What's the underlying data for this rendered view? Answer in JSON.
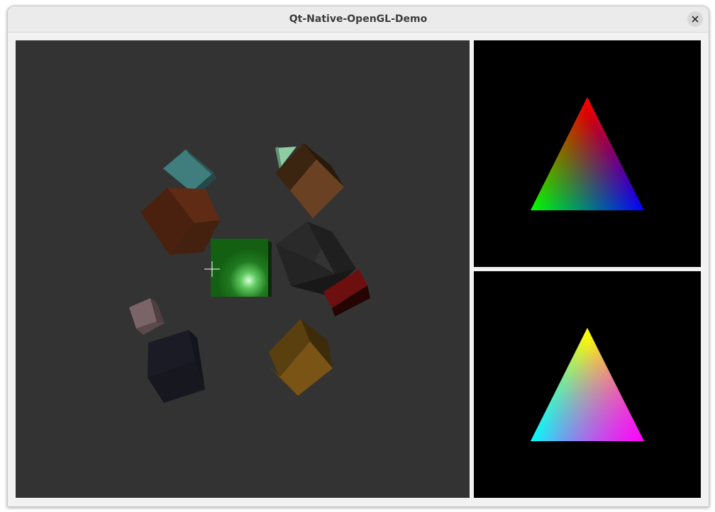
{
  "window": {
    "title": "Qt-Native-OpenGL-Demo"
  },
  "titlebar": {
    "close_icon": "close-icon"
  },
  "views": {
    "main_view": "cubes-scene",
    "side_top_view": "rgb-triangle",
    "side_bottom_view": "cmy-triangle"
  },
  "colors": {
    "main_background": "#333333",
    "side_background": "#000000",
    "triangle_top": [
      "#ff0000",
      "#00ff00",
      "#0000ff"
    ],
    "triangle_bottom": [
      "#ffff00",
      "#00ffff",
      "#ff00ff"
    ]
  }
}
